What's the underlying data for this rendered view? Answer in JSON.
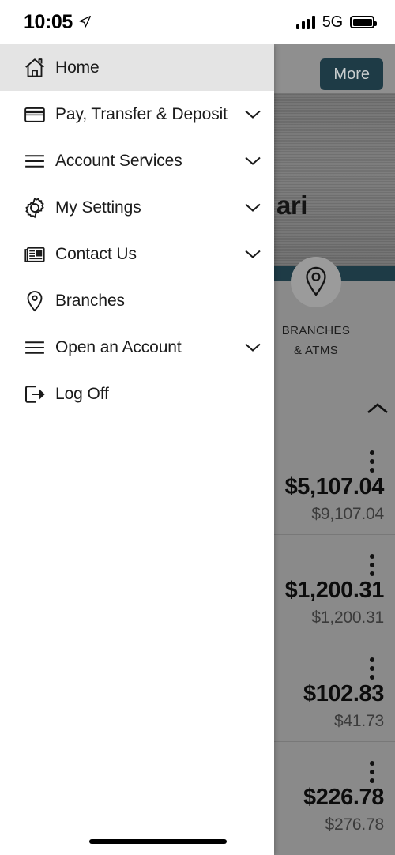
{
  "status_bar": {
    "time": "10:05",
    "location_icon": "location-arrow-icon",
    "signal_icon": "signal-bars-icon",
    "network": "5G",
    "battery_icon": "battery-full-icon"
  },
  "drawer": {
    "items": [
      {
        "label": "Home",
        "icon": "home-icon",
        "expandable": false,
        "active": true
      },
      {
        "label": "Pay, Transfer & Deposit",
        "icon": "credit-card-icon",
        "expandable": true,
        "active": false
      },
      {
        "label": "Account Services",
        "icon": "hamburger-icon",
        "expandable": true,
        "active": false
      },
      {
        "label": "My Settings",
        "icon": "gear-icon",
        "expandable": true,
        "active": false
      },
      {
        "label": "Contact Us",
        "icon": "newspaper-icon",
        "expandable": true,
        "active": false
      },
      {
        "label": "Branches",
        "icon": "map-pin-icon",
        "expandable": false,
        "active": false
      },
      {
        "label": "Open an Account",
        "icon": "hamburger-icon",
        "expandable": true,
        "active": false
      },
      {
        "label": "Log Off",
        "icon": "logout-icon",
        "expandable": false,
        "active": false
      }
    ]
  },
  "background": {
    "more_button": "More",
    "greeting_fragment": "ari",
    "quick_action": {
      "icon": "map-pin-icon",
      "line1": "BRANCHES",
      "line2": "& ATMS"
    },
    "collapse_icon": "chevron-up-icon",
    "accounts": [
      {
        "primary": "$5,107.04",
        "secondary": "$9,107.04",
        "menu_icon": "kebab-menu-icon"
      },
      {
        "primary": "$1,200.31",
        "secondary": "$1,200.31",
        "menu_icon": "kebab-menu-icon"
      },
      {
        "primary": "$102.83",
        "secondary": "$41.73",
        "menu_icon": "kebab-menu-icon"
      },
      {
        "primary": "$226.78",
        "secondary": "$276.78",
        "menu_icon": "kebab-menu-icon"
      }
    ]
  },
  "colors": {
    "brand_dark_teal": "#1e3b46",
    "drawer_active": "#e4e4e4",
    "dim_overlay": "#8a8a8a"
  }
}
